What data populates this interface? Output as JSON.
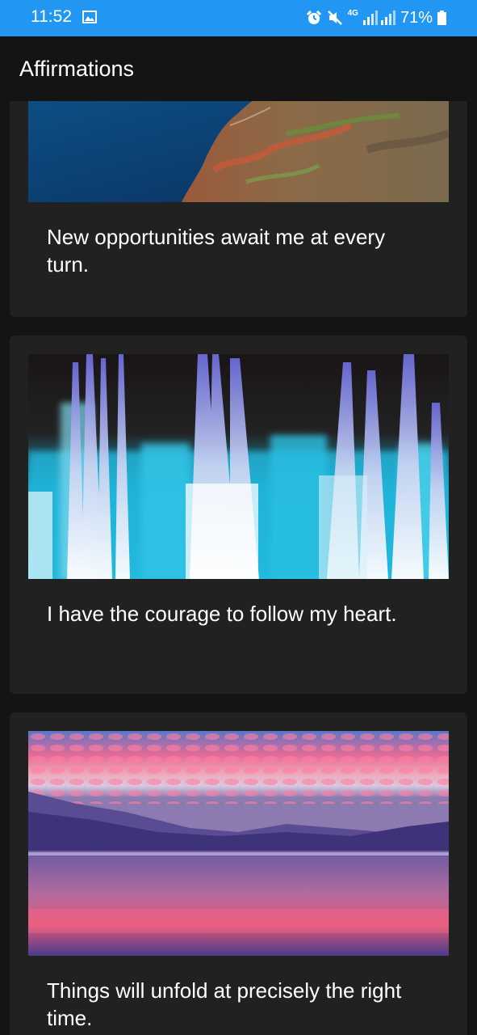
{
  "status_bar": {
    "time": "11:52",
    "network": "4G",
    "battery": "71%",
    "background_color": "#2196f3",
    "icons": [
      "gallery-icon",
      "alarm-icon",
      "mute-icon",
      "signal-icon",
      "battery-icon"
    ]
  },
  "app_bar": {
    "title": "Affirmations"
  },
  "cards": [
    {
      "image": "coastal-cliffs-aerial-photo",
      "text": "New opportunities await me at every turn."
    },
    {
      "image": "blue-light-fibers-photo",
      "text": "I have the courage to follow my heart."
    },
    {
      "image": "pink-sunset-lake-photo",
      "text": "Things will unfold at precisely the right time."
    }
  ]
}
